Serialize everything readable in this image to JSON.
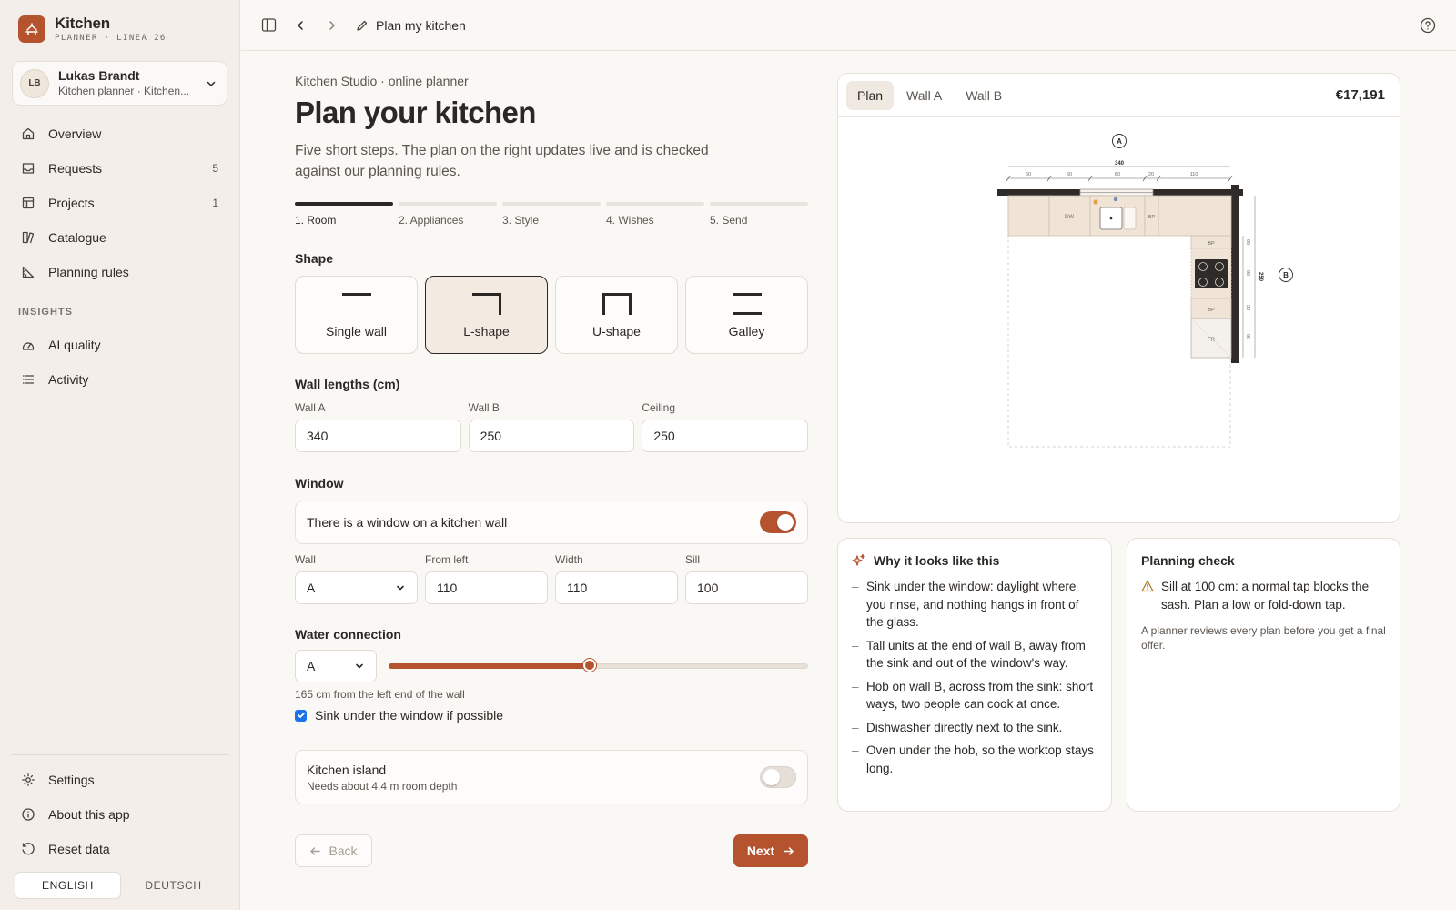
{
  "brand": {
    "title": "Kitchen",
    "subtitle": "PLANNER · LINEA 26"
  },
  "user": {
    "initials": "LB",
    "name": "Lukas Brandt",
    "role": "Kitchen planner · Kitchen..."
  },
  "nav": {
    "items": [
      {
        "label": "Overview",
        "count": ""
      },
      {
        "label": "Requests",
        "count": "5"
      },
      {
        "label": "Projects",
        "count": "1"
      },
      {
        "label": "Catalogue",
        "count": ""
      },
      {
        "label": "Planning rules",
        "count": ""
      }
    ],
    "insights_heading": "INSIGHTS",
    "insights": [
      {
        "label": "AI quality"
      },
      {
        "label": "Activity"
      }
    ],
    "bottom": [
      {
        "label": "Settings"
      },
      {
        "label": "About this app"
      },
      {
        "label": "Reset data"
      }
    ]
  },
  "languages": {
    "active": "ENGLISH",
    "other": "DEUTSCH"
  },
  "topbar": {
    "breadcrumb": "Plan my kitchen"
  },
  "main": {
    "eyebrow": "Kitchen Studio · online planner",
    "title": "Plan your kitchen",
    "intro": "Five short steps. The plan on the right updates live and is checked against our planning rules.",
    "steps": [
      "1. Room",
      "2. Appliances",
      "3. Style",
      "4. Wishes",
      "5. Send"
    ],
    "active_step": 0
  },
  "shape": {
    "title": "Shape",
    "options": [
      "Single wall",
      "L-shape",
      "U-shape",
      "Galley"
    ],
    "selected": "L-shape"
  },
  "walls": {
    "title": "Wall lengths (cm)",
    "wall_a_label": "Wall A",
    "wall_a": "340",
    "wall_b_label": "Wall B",
    "wall_b": "250",
    "ceiling_label": "Ceiling",
    "ceiling": "250"
  },
  "window": {
    "title": "Window",
    "toggle_label": "There is a window on a kitchen wall",
    "enabled": true,
    "wall_label": "Wall",
    "wall": "A",
    "from_left_label": "From left",
    "from_left": "110",
    "width_label": "Width",
    "width": "110",
    "sill_label": "Sill",
    "sill": "100"
  },
  "water": {
    "title": "Water connection",
    "wall": "A",
    "slider_fraction": 0.48,
    "hint": "165 cm from the left end of the wall",
    "sink_under_window": "Sink under the window if possible",
    "sink_checked": true
  },
  "island": {
    "title": "Kitchen island",
    "hint": "Needs about 4.4 m room depth",
    "enabled": false
  },
  "buttons": {
    "back": "Back",
    "next": "Next"
  },
  "plan": {
    "tabs": [
      "Plan",
      "Wall A",
      "Wall B"
    ],
    "active_tab": "Plan",
    "price": "€17,191",
    "wall_a_marker": "A",
    "wall_b_marker": "B",
    "total_a": "340",
    "total_b": "250",
    "segments_a": [
      "60",
      "60",
      "80",
      "20",
      "110"
    ],
    "segments_b": [
      "60",
      "60",
      "30",
      "60"
    ],
    "unit_dw": "DW",
    "unit_bp": "BP",
    "unit_fr": "FR"
  },
  "why": {
    "title": "Why it looks like this",
    "items": [
      "Sink under the window: daylight where you rinse, and nothing hangs in front of the glass.",
      "Tall units at the end of wall B, away from the sink and out of the window's way.",
      "Hob on wall B, across from the sink: short ways, two people can cook at once.",
      "Dishwasher directly next to the sink.",
      "Oven under the hob, so the worktop stays long."
    ]
  },
  "check": {
    "title": "Planning check",
    "warning": "Sill at 100 cm: a normal tap blocks the sash. Plan a low or fold-down tap.",
    "note": "A planner reviews every plan before you get a final offer."
  },
  "colors": {
    "accent": "#b5532f",
    "text": "#2b2724",
    "muted": "#5c554f",
    "bg": "#faf8f5"
  }
}
